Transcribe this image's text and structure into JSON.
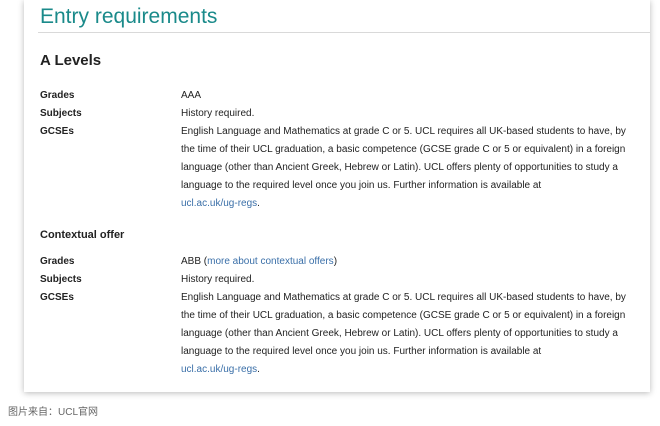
{
  "page_title": "Entry requirements",
  "a_levels": {
    "heading": "A Levels",
    "rows": [
      {
        "label": "Grades",
        "value": "AAA"
      },
      {
        "label": "Subjects",
        "value": "History required."
      },
      {
        "label": "GCSEs",
        "value": "English Language and Mathematics at grade C or 5. UCL requires all UK-based students to have, by the time of their UCL graduation, a basic competence (GCSE grade C or 5 or equivalent) in a foreign language (other than Ancient Greek, Hebrew or Latin). UCL offers plenty of opportunities to study a language to the required level once you join us. Further information is available at",
        "link": "ucl.ac.uk/ug-regs",
        "suffix": "."
      }
    ]
  },
  "contextual_offer": {
    "heading": "Contextual offer",
    "grades_label": "Grades",
    "grades_value": "ABB (",
    "grades_link": "more about contextual offers",
    "grades_suffix": ")",
    "subjects_label": "Subjects",
    "subjects_value": "History required.",
    "gcses_label": "GCSEs",
    "gcses_value": "English Language and Mathematics at grade C or 5. UCL requires all UK-based students to have, by the time of their UCL graduation, a basic competence (GCSE grade C or 5 or equivalent) in a foreign language (other than Ancient Greek, Hebrew or Latin). UCL offers plenty of opportunities to study a language to the required level once you join us. Further information is available at",
    "gcses_link": "ucl.ac.uk/ug-regs",
    "gcses_suffix": "."
  },
  "caption": "图片来自：UCL官网",
  "colors": {
    "title": "#1a8a8a",
    "link": "#3a6fa8"
  }
}
